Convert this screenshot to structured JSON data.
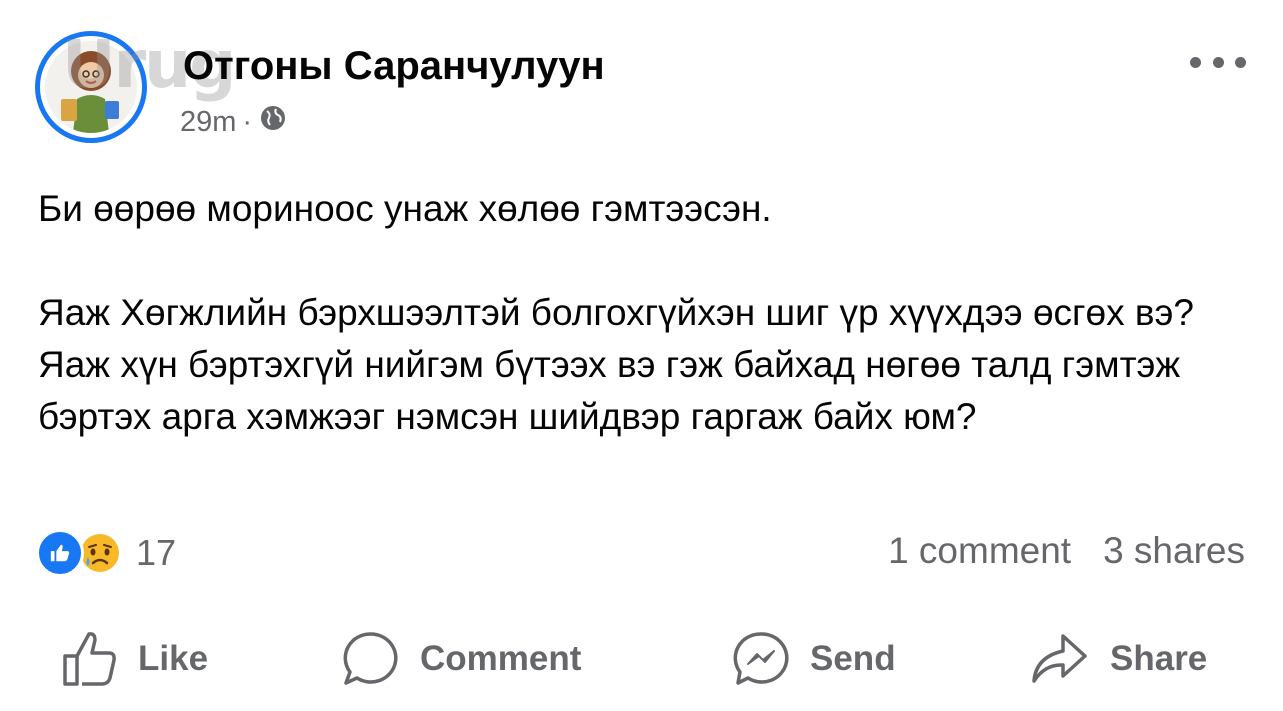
{
  "post": {
    "author": "Отгоны Саранчулуун",
    "time": "29m",
    "separator": "·",
    "watermark": "Urug",
    "paragraphs": [
      "Би өөрөө мориноос унаж хөлөө гэмтээсэн.",
      "Яаж Хөгжлийн бэрхшээлтэй болгохгүйхэн шиг үр хүүхдээ өсгөх вэ? Яаж хүн бэртэхгүй нийгэм бүтээх вэ гэж байхад нөгөө талд гэмтэж бэртэх арга хэмжээг нэмсэн шийдвэр гаргаж байх юм?"
    ],
    "reactions": {
      "icons": [
        "like-icon",
        "sad-icon"
      ],
      "count": "17"
    },
    "comments": "1 comment",
    "shares": "3 shares",
    "actions": {
      "like": "Like",
      "comment": "Comment",
      "send": "Send",
      "share": "Share"
    },
    "colors": {
      "accent": "#1877f2",
      "muted": "#65676b",
      "text": "#050505"
    }
  }
}
